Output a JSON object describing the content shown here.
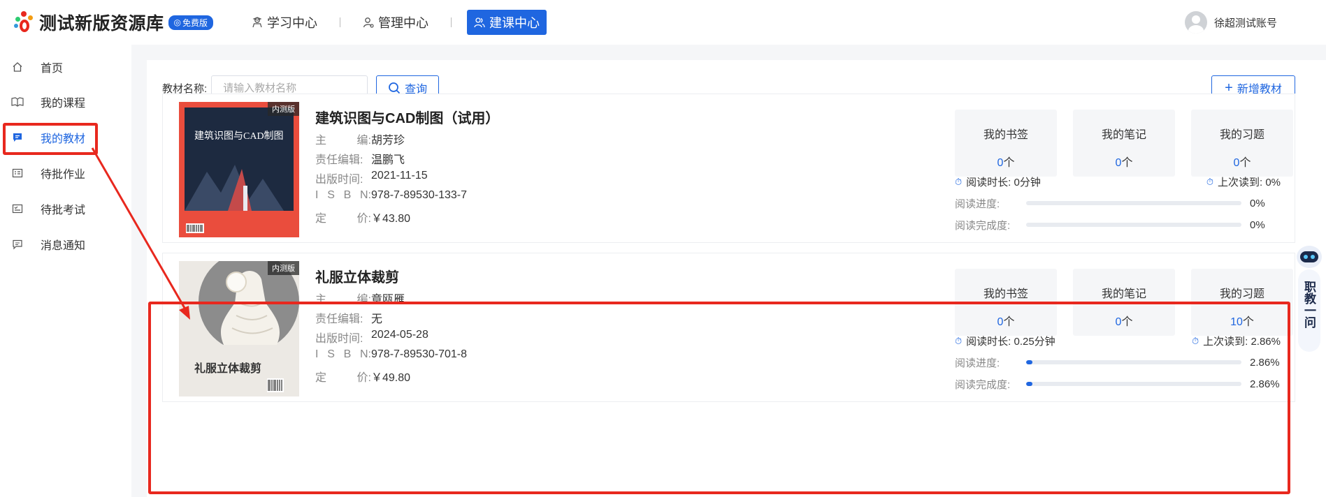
{
  "header": {
    "app_title": "测试新版资源库",
    "badge": "免费版",
    "nav": [
      {
        "label": "学习中心",
        "icon": "graduate-icon"
      },
      {
        "label": "管理中心",
        "icon": "user-gear-icon"
      },
      {
        "label": "建课中心",
        "icon": "users-icon",
        "active": true
      }
    ],
    "user_name": "徐超测试账号"
  },
  "sidebar": {
    "items": [
      {
        "label": "首页",
        "icon": "home-icon"
      },
      {
        "label": "我的课程",
        "icon": "book-open-icon"
      },
      {
        "label": "我的教材",
        "icon": "chat-bubble-icon",
        "active": true
      },
      {
        "label": "待批作业",
        "icon": "homework-icon"
      },
      {
        "label": "待批考试",
        "icon": "exam-icon"
      },
      {
        "label": "消息通知",
        "icon": "message-icon"
      }
    ]
  },
  "search": {
    "label": "教材名称:",
    "placeholder": "请输入教材名称",
    "query_label": "查询",
    "add_label": "新增教材"
  },
  "books": [
    {
      "tag": "内测版",
      "cover_title": "建筑识图与CAD制图",
      "title": "建筑识图与CAD制图（试用）",
      "fields": [
        {
          "key": "主 编:",
          "value": "胡芳珍"
        },
        {
          "key": "责任编辑:",
          "value": "温鹏飞"
        },
        {
          "key": "出版时间:",
          "value": "2021-11-15"
        },
        {
          "key": "I S B N:",
          "value": "978-7-89530-133-7"
        },
        {
          "key": "定 价:",
          "value": "￥43.80"
        }
      ],
      "stats": [
        {
          "label": "我的书签",
          "count": "0",
          "unit": "个"
        },
        {
          "label": "我的笔记",
          "count": "0",
          "unit": "个"
        },
        {
          "label": "我的习题",
          "count": "0",
          "unit": "个"
        }
      ],
      "read_time": "阅读时长: 0分钟",
      "last_read": "上次读到: 0%",
      "progress_label": "阅读进度:",
      "progress_value": "0%",
      "progress_fraction": 0,
      "completion_label": "阅读完成度:",
      "completion_value": "0%",
      "completion_fraction": 0
    },
    {
      "tag": "内测版",
      "cover_title": "礼服立体裁剪",
      "title": "礼服立体裁剪",
      "fields": [
        {
          "key": "主 编:",
          "value": "章瓯雁"
        },
        {
          "key": "责任编辑:",
          "value": "无"
        },
        {
          "key": "出版时间:",
          "value": "2024-05-28"
        },
        {
          "key": "I S B N:",
          "value": "978-7-89530-701-8"
        },
        {
          "key": "定 价:",
          "value": "￥49.80"
        }
      ],
      "stats": [
        {
          "label": "我的书签",
          "count": "0",
          "unit": "个"
        },
        {
          "label": "我的笔记",
          "count": "0",
          "unit": "个"
        },
        {
          "label": "我的习题",
          "count": "10",
          "unit": "个"
        }
      ],
      "read_time": "阅读时长: 0.25分钟",
      "last_read": "上次读到: 2.86%",
      "progress_label": "阅读进度:",
      "progress_value": "2.86%",
      "progress_fraction": 0.0286,
      "completion_label": "阅读完成度:",
      "completion_value": "2.86%",
      "completion_fraction": 0.0286
    }
  ],
  "assistant": {
    "label": "职教一问"
  },
  "colors": {
    "accent": "#1f66e0",
    "highlight": "#e8281e"
  }
}
